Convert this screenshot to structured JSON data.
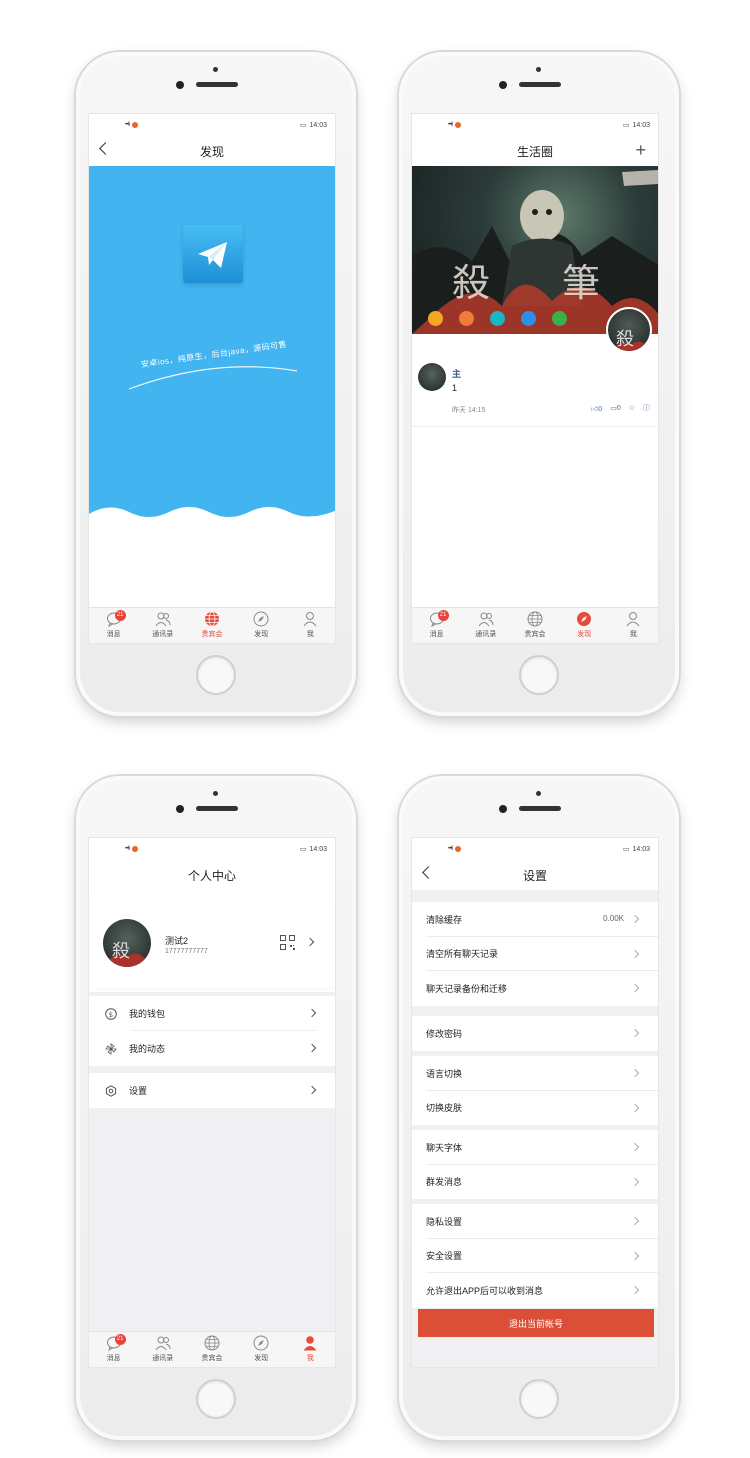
{
  "status_bar": {
    "time": "14:03",
    "signal": "•••ll"
  },
  "tabbar": {
    "items": [
      {
        "label": "消息",
        "icon": "chat-bubble-icon"
      },
      {
        "label": "通讯录",
        "icon": "contacts-icon"
      },
      {
        "label": "贵宾会",
        "icon": "globe-icon"
      },
      {
        "label": "发现",
        "icon": "compass-icon"
      },
      {
        "label": "我",
        "icon": "person-icon"
      }
    ],
    "badge": "21",
    "active_color": "#e54a3c"
  },
  "screen1": {
    "title": "发现",
    "slogan": "安卓ios，纯原生，后台java，源码可售",
    "bg_color": "#42b4f0",
    "active_tab": 2
  },
  "screen2": {
    "title": "生活圈",
    "plus": "+",
    "post": {
      "name": "主",
      "text": "1",
      "time": "昨天 14:15",
      "likes": "0",
      "comments": "0"
    },
    "active_tab": 3,
    "action_circle_colors": [
      "#f6a623",
      "#f07c3a",
      "#19b5c2",
      "#2f8fe6",
      "#3bb04a"
    ]
  },
  "screen3": {
    "title": "个人中心",
    "profile": {
      "name": "测试2",
      "phone": "17777777777"
    },
    "menu": [
      {
        "label": "我的钱包",
        "icon": "dollar-icon"
      },
      {
        "label": "我的动态",
        "icon": "pinwheel-icon"
      },
      {
        "label": "设置",
        "icon": "hexagon-settings-icon"
      }
    ],
    "active_tab": 4
  },
  "screen4": {
    "title": "设置",
    "groups": [
      [
        {
          "label": "清除缓存",
          "value": "0.00K"
        },
        {
          "label": "清空所有聊天记录"
        },
        {
          "label": "聊天记录备份和迁移"
        }
      ],
      [
        {
          "label": "修改密码"
        }
      ],
      [
        {
          "label": "语言切换"
        },
        {
          "label": "切换皮肤"
        }
      ],
      [
        {
          "label": "聊天字体"
        },
        {
          "label": "群发消息"
        }
      ],
      [
        {
          "label": "隐私设置"
        },
        {
          "label": "安全设置"
        },
        {
          "label": "允许退出APP后可以收到消息"
        }
      ]
    ],
    "logout": "退出当前帐号",
    "logout_color": "#db4f36"
  }
}
